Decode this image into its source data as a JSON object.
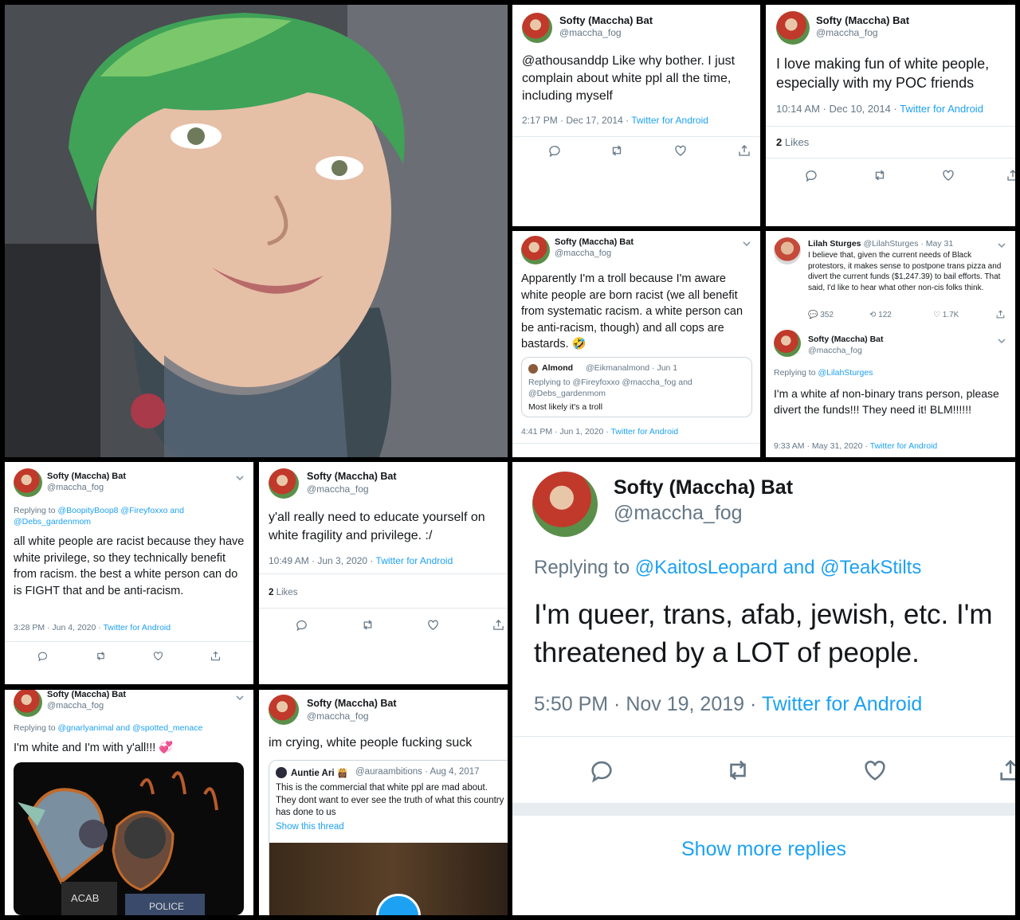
{
  "common": {
    "client": "Twitter for Android",
    "dot": "·"
  },
  "p_photo": {},
  "p1": {
    "name": "Softy (Maccha) Bat",
    "handle": "@maccha_fog",
    "body": "@athousanddp Like why bother. I just complain about white ppl all the time, including myself",
    "time": "2:17 PM · Dec 17, 2014 ·"
  },
  "p2": {
    "name": "Softy (Maccha) Bat",
    "handle": "@maccha_fog",
    "body": "I love making fun of white people, especially with my POC friends",
    "time": "10:14 AM · Dec 10, 2014 ·",
    "likes_count": "2",
    "likes_label": "Likes"
  },
  "p3": {
    "name": "Softy (Maccha) Bat",
    "handle": "@maccha_fog",
    "body": "Apparently I'm a troll because I'm aware white people are born racist (we all benefit from systematic racism. a white person can be anti-racism, though) and all cops are bastards. 🤣",
    "quote_name": "Almond",
    "quote_handle": "@Eikmanalmond · Jun 1",
    "quote_reply": "Replying to @Fireyfoxxo @maccha_fog and @Debs_gardenmom",
    "quote_body": "Most likely it's a troll",
    "time": "4:41 PM · Jun 1, 2020 ·"
  },
  "p4": {
    "l_name": "Lilah Sturges",
    "l_handle": "@LilahSturges · May 31",
    "l_body": "I believe that, given the current needs of Black protestors, it makes sense to postpone trans pizza and divert the current funds ($1,247.39) to bail efforts. That said, I'd like to hear what other non-cis folks think.",
    "l_replies": "352",
    "l_rts": "122",
    "l_likes": "1.7K",
    "name": "Softy (Maccha) Bat",
    "handle": "@maccha_fog",
    "reply_prefix": "Replying to",
    "reply_to": "@LilahSturges",
    "body": "I'm a white af non-binary trans person, please divert the funds!!! They need it! BLM!!!!!!",
    "time": "9:33 AM · May 31, 2020 ·"
  },
  "p5": {
    "name": "Softy (Maccha) Bat",
    "handle": "@maccha_fog",
    "reply_prefix": "Replying to",
    "reply_to": "@BoopityBoop8 @Fireyfoxxo and @Debs_gardenmom",
    "body": "all white people are racist because they have white privilege, so they technically benefit from racism. the best a white person can do is FIGHT that and be anti-racism.",
    "time": "3:28 PM · Jun 4, 2020 ·"
  },
  "p6": {
    "name": "Softy (Maccha) Bat",
    "handle": "@maccha_fog",
    "body": "y'all really need to educate yourself on white fragility and privilege. :/",
    "time": "10:49 AM · Jun 3, 2020 ·",
    "likes_count": "2",
    "likes_label": "Likes"
  },
  "p7": {
    "name": "Softy (Maccha) Bat",
    "handle": "@maccha_fog",
    "reply_prefix": "Replying to",
    "reply_to": "@gnarlyanimal and @spotted_menace",
    "body": "I'm white and I'm with y'all!!! 💞",
    "img_text1": "ACAB",
    "img_text2": "POLICE"
  },
  "p8": {
    "name": "Softy (Maccha) Bat",
    "handle": "@maccha_fog",
    "body": "im crying, white people fucking suck",
    "quote_name": "Auntie Ari 👸🏾",
    "quote_handle": "@auraambitions · Aug 4, 2017",
    "quote_body": "This is the commercial that white ppl are mad about. They dont want to ever see the truth of what this country has done to us",
    "quote_link": "Show this thread"
  },
  "p9": {
    "name": "Softy (Maccha) Bat",
    "handle": "@maccha_fog",
    "reply_prefix": "Replying to",
    "reply_to": "@KaitosLeopard and @TeakStilts",
    "body": "I'm queer, trans, afab, jewish, etc. I'm threatened by a LOT of people.",
    "time": "5:50 PM · Nov 19, 2019 ·",
    "more": "Show more replies"
  }
}
